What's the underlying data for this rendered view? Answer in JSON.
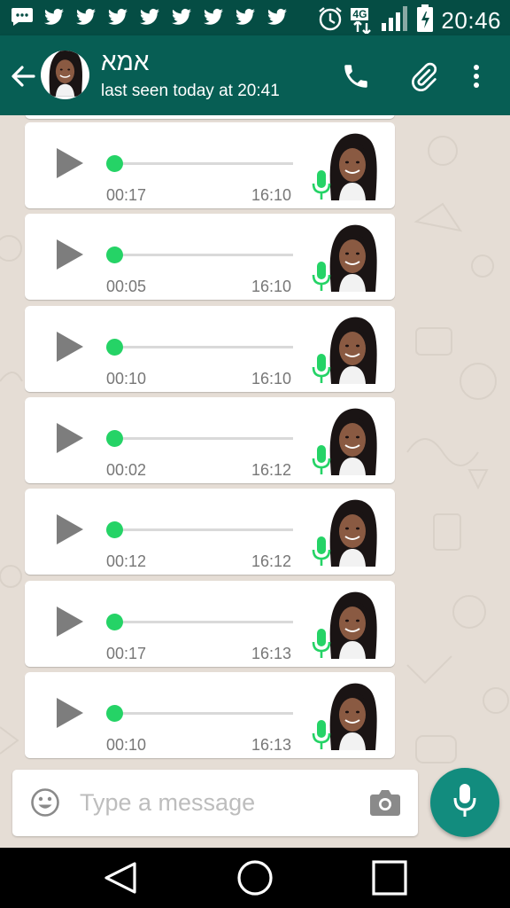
{
  "status_bar": {
    "time": "20:46",
    "network": "4G",
    "notifications": [
      "chat-icon",
      "twitter-icon",
      "twitter-icon",
      "twitter-icon",
      "twitter-icon",
      "twitter-icon",
      "twitter-icon",
      "twitter-icon",
      "twitter-icon"
    ]
  },
  "header": {
    "contact_name": "אמא",
    "last_seen": "last seen today at 20:41"
  },
  "messages": [
    {
      "duration": "00:17",
      "time": "16:10"
    },
    {
      "duration": "00:05",
      "time": "16:10"
    },
    {
      "duration": "00:10",
      "time": "16:10"
    },
    {
      "duration": "00:02",
      "time": "16:12"
    },
    {
      "duration": "00:12",
      "time": "16:12"
    },
    {
      "duration": "00:17",
      "time": "16:13"
    },
    {
      "duration": "00:10",
      "time": "16:13"
    }
  ],
  "composer": {
    "placeholder": "Type a message"
  },
  "colors": {
    "header": "#075e54",
    "status_bar": "#054d44",
    "accent_green": "#25d366",
    "fab": "#128c7e",
    "chat_background": "#e5ddd5"
  }
}
